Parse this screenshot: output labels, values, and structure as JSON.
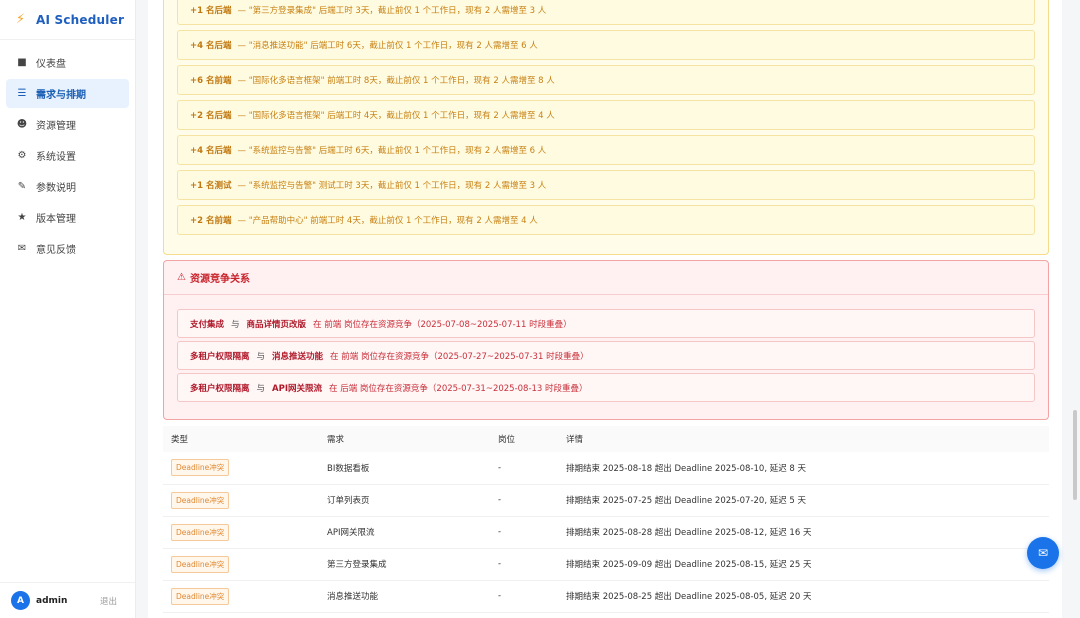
{
  "app": {
    "title": "AI Scheduler"
  },
  "sidebar": {
    "items": [
      {
        "label": "仪表盘",
        "icon": "dashboard-icon"
      },
      {
        "label": "需求与排期",
        "icon": "list-icon"
      },
      {
        "label": "资源管理",
        "icon": "user-icon"
      },
      {
        "label": "系统设置",
        "icon": "gear-icon"
      },
      {
        "label": "参数说明",
        "icon": "pencil-icon"
      },
      {
        "label": "版本管理",
        "icon": "star-icon"
      },
      {
        "label": "意见反馈",
        "icon": "mail-icon"
      }
    ],
    "active": "需求与排期"
  },
  "user": {
    "initial": "A",
    "name": "admin",
    "logout": "退出"
  },
  "warnings": [
    {
      "strong": "+1 名后端",
      "text": "— \"第三方登录集成\" 后端工时 3天，截止前仅 1 个工作日，现有 2 人需增至 3 人"
    },
    {
      "strong": "+4 名后端",
      "text": "— \"消息推送功能\" 后端工时 6天，截止前仅 1 个工作日，现有 2 人需增至 6 人"
    },
    {
      "strong": "+6 名前端",
      "text": "— \"国际化多语言框架\" 前端工时 8天，截止前仅 1 个工作日，现有 2 人需增至 8 人"
    },
    {
      "strong": "+2 名后端",
      "text": "— \"国际化多语言框架\" 后端工时 4天，截止前仅 1 个工作日，现有 2 人需增至 4 人"
    },
    {
      "strong": "+4 名后端",
      "text": "— \"系统监控与告警\" 后端工时 6天，截止前仅 1 个工作日，现有 2 人需增至 6 人"
    },
    {
      "strong": "+1 名测试",
      "text": "— \"系统监控与告警\" 测试工时 3天，截止前仅 1 个工作日，现有 2 人需增至 3 人"
    },
    {
      "strong": "+2 名前端",
      "text": "— \"产品帮助中心\" 前端工时 4天，截止前仅 1 个工作日，现有 2 人需增至 4 人"
    }
  ],
  "conflicts": {
    "title": "资源竞争关系",
    "items": [
      {
        "a": "支付集成",
        "mid": "与",
        "b": "商品详情页改版",
        "text": "在 前端 岗位存在资源竞争（2025-07-08~2025-07-11 时段重叠）"
      },
      {
        "a": "多租户权限隔离",
        "mid": "与",
        "b": "消息推送功能",
        "text": "在 前端 岗位存在资源竞争（2025-07-27~2025-07-31 时段重叠）"
      },
      {
        "a": "多租户权限隔离",
        "mid": "与",
        "b": "API网关限流",
        "text": "在 后端 岗位存在资源竞争（2025-07-31~2025-08-13 时段重叠）"
      }
    ]
  },
  "table": {
    "headers": [
      "类型",
      "需求",
      "岗位",
      "详情"
    ],
    "rows": [
      {
        "type": "Deadline冲突",
        "req": "BI数据看板",
        "role": "-",
        "detail": "排期结束 2025-08-18 超出 Deadline 2025-08-10, 延迟 8 天"
      },
      {
        "type": "Deadline冲突",
        "req": "订单列表页",
        "role": "-",
        "detail": "排期结束 2025-07-25 超出 Deadline 2025-07-20, 延迟 5 天"
      },
      {
        "type": "Deadline冲突",
        "req": "API网关限流",
        "role": "-",
        "detail": "排期结束 2025-08-28 超出 Deadline 2025-08-12, 延迟 16 天"
      },
      {
        "type": "Deadline冲突",
        "req": "第三方登录集成",
        "role": "-",
        "detail": "排期结束 2025-09-09 超出 Deadline 2025-08-15, 延迟 25 天"
      },
      {
        "type": "Deadline冲突",
        "req": "消息推送功能",
        "role": "-",
        "detail": "排期结束 2025-08-25 超出 Deadline 2025-08-05, 延迟 20 天"
      }
    ]
  },
  "colors": {
    "brand": "#1a73e8",
    "warning": "#c78012",
    "danger": "#c8232c",
    "tag": "#e08a33"
  }
}
